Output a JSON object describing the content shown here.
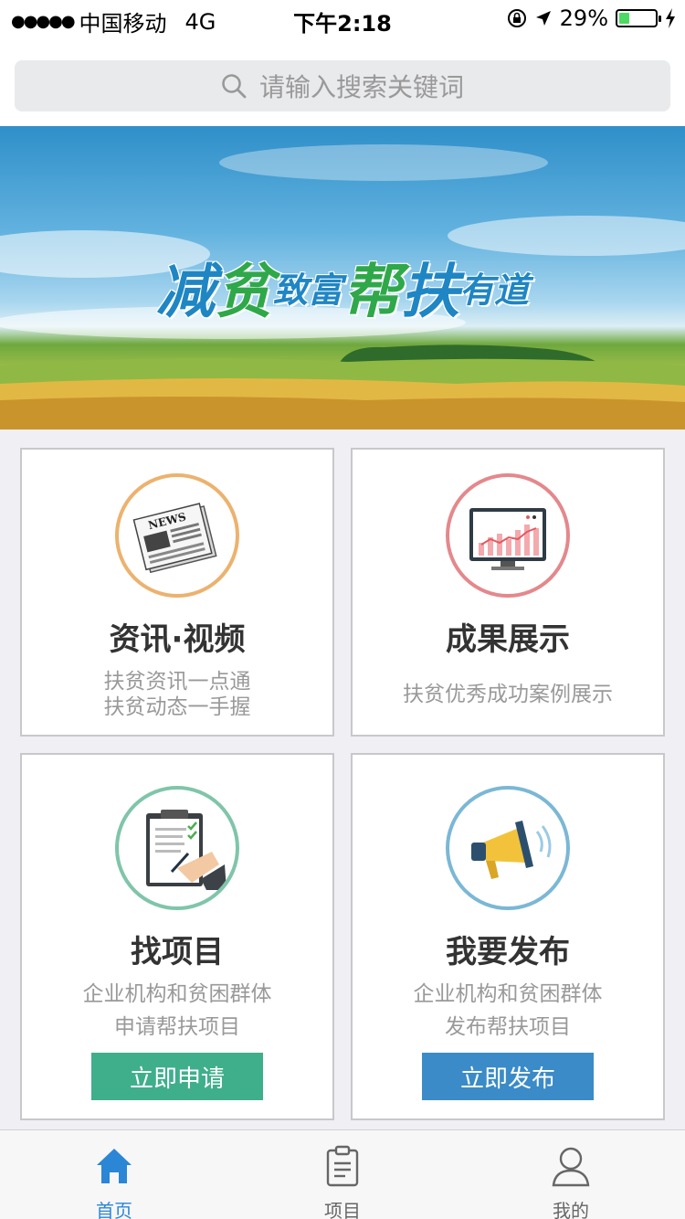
{
  "status_bar": {
    "carrier": "中国移动",
    "network": "4G",
    "time": "下午2:18",
    "battery_percent": "29%",
    "battery_level": 0.29,
    "signal_dots": "●●●●●"
  },
  "search": {
    "placeholder": "请输入搜索关键词",
    "icon": "search-icon"
  },
  "banner": {
    "slogan_parts": [
      "减",
      "贫",
      "致富",
      "帮",
      "扶",
      "有道"
    ]
  },
  "cards": [
    {
      "title": "资讯·视频",
      "desc_lines": [
        "扶贫资讯一点通",
        "扶贫动态一手握"
      ],
      "icon": "newspaper-icon",
      "ring_color": "#ecb26e"
    },
    {
      "title": "成果展示",
      "desc_lines": [
        "扶贫优秀成功案例展示"
      ],
      "icon": "chart-monitor-icon",
      "ring_color": "#e4888c"
    },
    {
      "title": "找项目",
      "desc_lines": [
        "企业机构和贫困群体",
        "申请帮扶项目"
      ],
      "icon": "clipboard-icon",
      "ring_color": "#7fc5aa",
      "button": "立即申请",
      "button_color": "#3fae8b"
    },
    {
      "title": "我要发布",
      "desc_lines": [
        "企业机构和贫困群体",
        "发布帮扶项目"
      ],
      "icon": "megaphone-icon",
      "ring_color": "#7bb7d6",
      "button": "立即发布",
      "button_color": "#3a8bc7"
    }
  ],
  "tabbar": {
    "items": [
      {
        "label": "首页",
        "icon": "home-icon",
        "active": true
      },
      {
        "label": "项目",
        "icon": "document-icon",
        "active": false
      },
      {
        "label": "我的",
        "icon": "user-icon",
        "active": false
      }
    ],
    "active_color": "#2b86d6"
  }
}
